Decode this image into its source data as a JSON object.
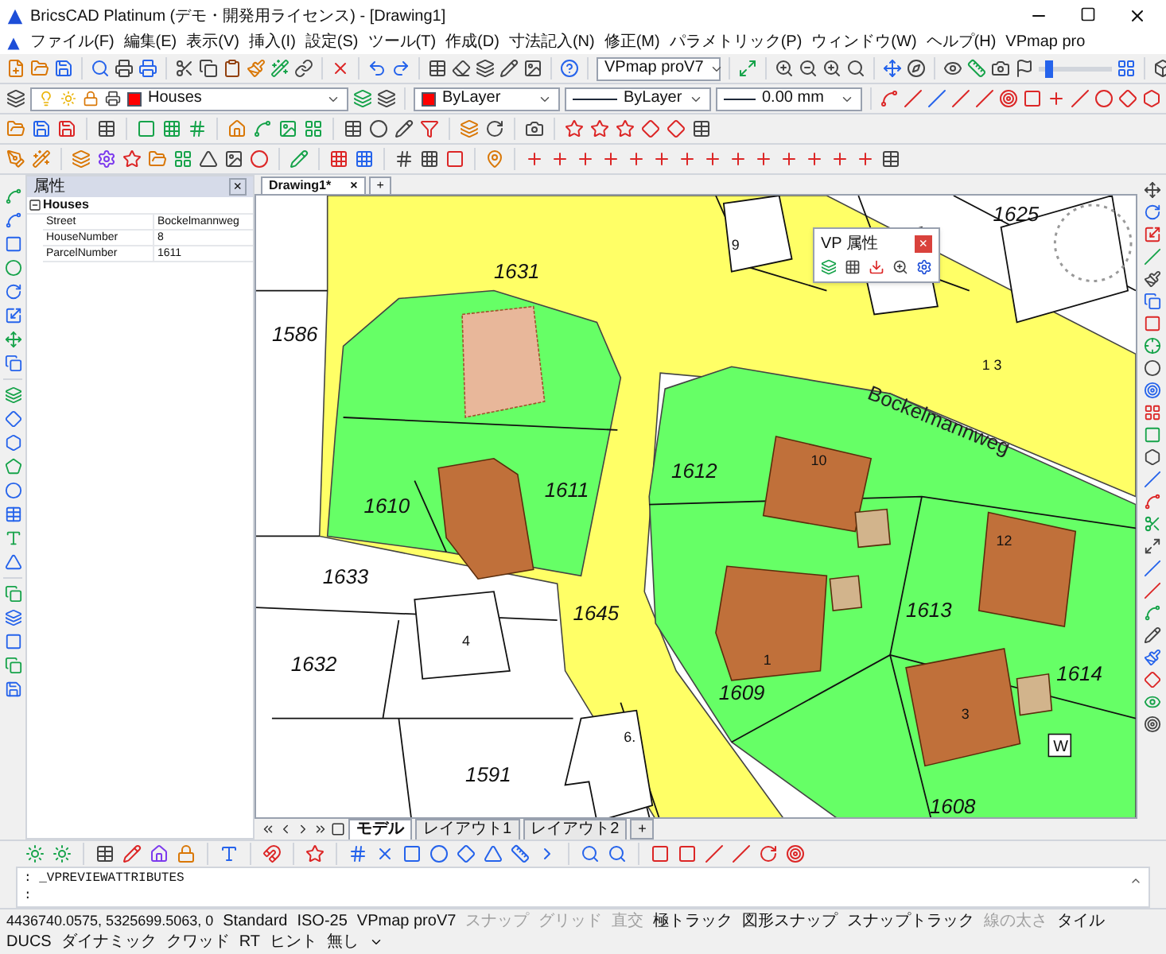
{
  "window": {
    "title": "BricsCAD Platinum (デモ・開発用ライセンス) - [Drawing1]"
  },
  "menu": [
    "ファイル(F)",
    "編集(E)",
    "表示(V)",
    "挿入(I)",
    "設定(S)",
    "ツール(T)",
    "作成(D)",
    "寸法記入(N)",
    "修正(M)",
    "パラメトリック(P)",
    "ウィンドウ(W)",
    "ヘルプ(H)",
    "VPmap pro"
  ],
  "toolbar": {
    "view_select": "VPmap proV7",
    "zoom_slider": {
      "level": 0.08
    },
    "layer": {
      "name": "Houses",
      "color": "#ff0000"
    },
    "entity_color": {
      "name": "ByLayer",
      "color": "#ff0000"
    },
    "linetype": "ByLayer",
    "lineweight": "0.00 mm"
  },
  "properties_panel": {
    "title": "属性",
    "close": "×",
    "group": {
      "name": "Houses",
      "expanded": true,
      "rows": [
        {
          "name": "Street",
          "value": "Bockelmannweg"
        },
        {
          "name": "HouseNumber",
          "value": "8"
        },
        {
          "name": "ParcelNumber",
          "value": "1611"
        }
      ]
    }
  },
  "document_tabs": [
    {
      "label": "Drawing1*",
      "selected": true,
      "close": "×"
    }
  ],
  "document_add": "+",
  "map": {
    "street": "Bockelmannweg",
    "parcel_labels": [
      "1631",
      "1586",
      "1611",
      "1610",
      "1612",
      "1633",
      "1632",
      "1645",
      "1613",
      "1609",
      "1614",
      "1608",
      "1591",
      "1625"
    ],
    "house_numbers": [
      "9",
      "4",
      "6.",
      "10",
      "12",
      "1",
      "3",
      "1 3"
    ],
    "marker": "W"
  },
  "vp_popup": {
    "title": "VP 属性",
    "close": "×"
  },
  "layout_tabs": [
    {
      "label": "モデル",
      "selected": true
    },
    {
      "label": "レイアウト1",
      "selected": false
    },
    {
      "label": "レイアウト2",
      "selected": false
    }
  ],
  "layout_add": "+",
  "command_line": {
    "history": ": _VPREVIEWATTRIBUTES",
    "prompt": ":"
  },
  "status_bar": {
    "coordinates": "4436740.0575, 5325699.5063, 0",
    "items": [
      {
        "label": "Standard",
        "on": true
      },
      {
        "label": "ISO-25",
        "on": true
      },
      {
        "label": "VPmap proV7",
        "on": true
      },
      {
        "label": "スナップ",
        "on": false
      },
      {
        "label": "グリッド",
        "on": false
      },
      {
        "label": "直交",
        "on": false
      },
      {
        "label": "極トラック",
        "on": true
      },
      {
        "label": "図形スナップ",
        "on": true
      },
      {
        "label": "スナップトラック",
        "on": true
      },
      {
        "label": "線の太さ",
        "on": false
      },
      {
        "label": "タイル",
        "on": true
      },
      {
        "label": "DUCS",
        "on": true
      },
      {
        "label": "ダイナミック",
        "on": true
      },
      {
        "label": "クワッド",
        "on": true
      },
      {
        "label": "RT",
        "on": true
      },
      {
        "label": "ヒント",
        "on": true
      },
      {
        "label": "無し",
        "on": true
      }
    ]
  }
}
